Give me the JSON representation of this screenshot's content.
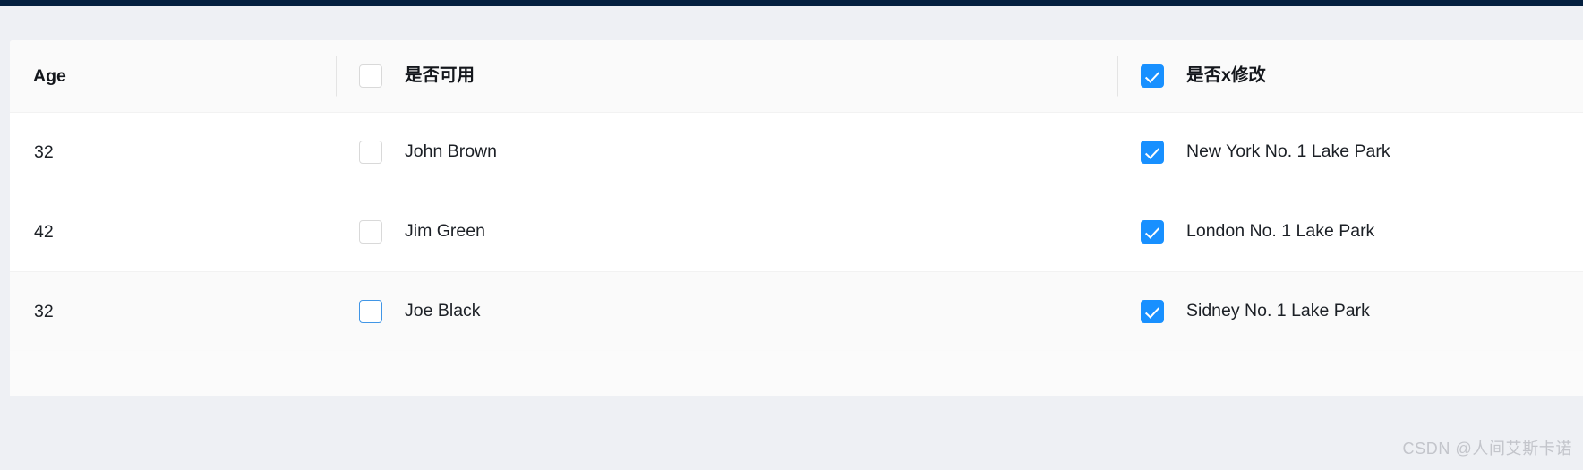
{
  "theme": {
    "top_bar_color": "#04203f",
    "page_background": "#eef0f4",
    "card_background": "#fbfbfb",
    "header_background": "#fafafa",
    "row_background": "#ffffff",
    "row_hover_background": "#fafafa",
    "accent_color": "#1890ff",
    "checkbox_border_color": "#d9d9d9",
    "checkbox_focus_border_color": "#4196e6",
    "divider_color": "#e4e4e4",
    "row_border_color": "#f2f2f2",
    "text_color": "#1c2026",
    "watermark_color": "#c3c5cb"
  },
  "table": {
    "columns": [
      {
        "key": "age",
        "header_label": "Age",
        "header_has_checkbox": false,
        "header_checked": false,
        "header_divider": false
      },
      {
        "key": "name",
        "header_label": "是否可用",
        "header_has_checkbox": true,
        "header_checked": false,
        "header_divider": true
      },
      {
        "key": "address",
        "header_label": "是否x修改",
        "header_has_checkbox": true,
        "header_checked": true,
        "header_divider": true
      }
    ],
    "rows": [
      {
        "age": "32",
        "name": "John Brown",
        "name_checked": false,
        "name_focused": false,
        "address": "New York No. 1 Lake Park",
        "address_checked": true,
        "hovered": false
      },
      {
        "age": "42",
        "name": "Jim Green",
        "name_checked": false,
        "name_focused": false,
        "address": "London No. 1 Lake Park",
        "address_checked": true,
        "hovered": false
      },
      {
        "age": "32",
        "name": "Joe Black",
        "name_checked": false,
        "name_focused": true,
        "address": "Sidney No. 1 Lake Park",
        "address_checked": true,
        "hovered": true
      }
    ]
  },
  "watermark": {
    "text": "CSDN @人间艾斯卡诺"
  }
}
